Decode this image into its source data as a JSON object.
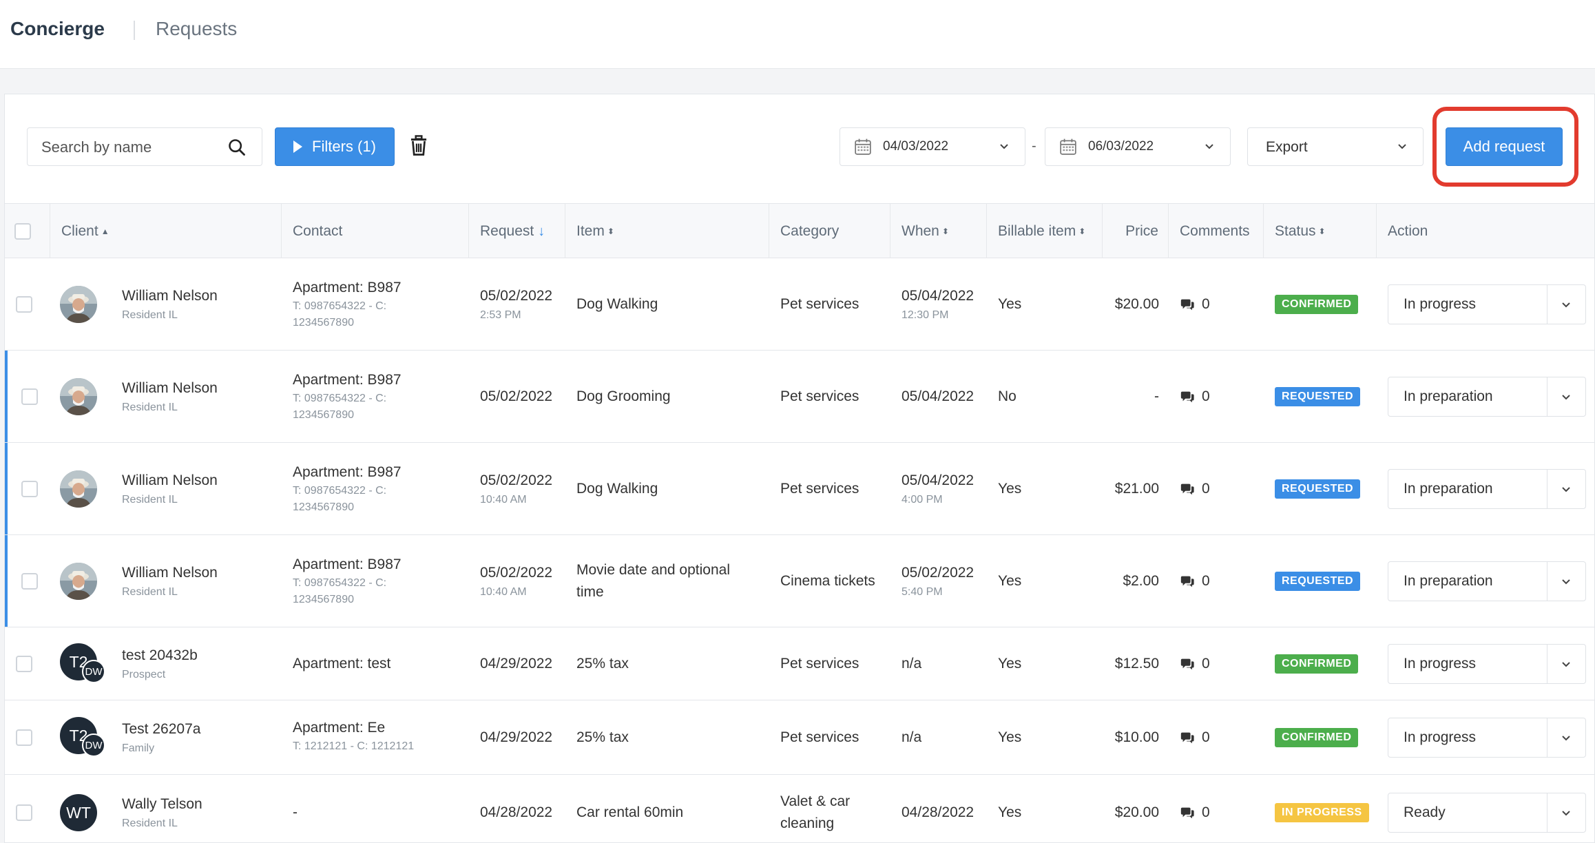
{
  "app": {
    "title": "Concierge",
    "breadcrumb": "Requests"
  },
  "toolbar": {
    "search_placeholder": "Search by name",
    "filters_label": "Filters (1)",
    "date_from": "04/03/2022",
    "date_dash": "-",
    "date_to": "06/03/2022",
    "export_label": "Export",
    "add_request_label": "Add request",
    "highlight_color": "#e23b2e",
    "accent_color": "#3b8ee6"
  },
  "table": {
    "headers": {
      "client": "Client",
      "contact": "Contact",
      "request": "Request",
      "item": "Item",
      "category": "Category",
      "when": "When",
      "billable": "Billable item",
      "price": "Price",
      "comments": "Comments",
      "status": "Status",
      "action": "Action"
    },
    "rows": [
      {
        "client_name": "William Nelson",
        "client_role": "Resident IL",
        "contact_main": "Apartment: B987",
        "contact_sub1": "T: 0987654322 - C:",
        "contact_sub2": "1234567890",
        "request_date": "05/02/2022",
        "request_time": "2:53 PM",
        "item": "Dog Walking",
        "category": "Pet services",
        "when_date": "05/04/2022",
        "when_time": "12:30 PM",
        "billable": "Yes",
        "price": "$20.00",
        "comments": "0",
        "status": "CONFIRMED",
        "action": "In progress"
      },
      {
        "client_name": "William Nelson",
        "client_role": "Resident IL",
        "contact_main": "Apartment: B987",
        "contact_sub1": "T: 0987654322 - C:",
        "contact_sub2": "1234567890",
        "request_date": "05/02/2022",
        "request_time": "",
        "item": "Dog Grooming",
        "category": "Pet services",
        "when_date": "05/04/2022",
        "when_time": "",
        "billable": "No",
        "price": "-",
        "comments": "0",
        "status": "REQUESTED",
        "action": "In preparation"
      },
      {
        "client_name": "William Nelson",
        "client_role": "Resident IL",
        "contact_main": "Apartment: B987",
        "contact_sub1": "T: 0987654322 - C:",
        "contact_sub2": "1234567890",
        "request_date": "05/02/2022",
        "request_time": "10:40 AM",
        "item": "Dog Walking",
        "category": "Pet services",
        "when_date": "05/04/2022",
        "when_time": "4:00 PM",
        "billable": "Yes",
        "price": "$21.00",
        "comments": "0",
        "status": "REQUESTED",
        "action": "In preparation"
      },
      {
        "client_name": "William Nelson",
        "client_role": "Resident IL",
        "contact_main": "Apartment: B987",
        "contact_sub1": "T: 0987654322 - C:",
        "contact_sub2": "1234567890",
        "request_date": "05/02/2022",
        "request_time": "10:40 AM",
        "item": "Movie date and optional time",
        "category": "Cinema tickets",
        "when_date": "05/02/2022",
        "when_time": "5:40 PM",
        "billable": "Yes",
        "price": "$2.00",
        "comments": "0",
        "status": "REQUESTED",
        "action": "In preparation"
      },
      {
        "client_name": "test 20432b",
        "client_role": "Prospect",
        "avatar_initials": "T2",
        "avatar_mini": "DW",
        "contact_main": "Apartment: test",
        "contact_sub1": "",
        "contact_sub2": "",
        "request_date": "04/29/2022",
        "request_time": "",
        "item": "25% tax",
        "category": "Pet services",
        "when_date": "n/a",
        "when_time": "",
        "billable": "Yes",
        "price": "$12.50",
        "comments": "0",
        "status": "CONFIRMED",
        "action": "In progress"
      },
      {
        "client_name": "Test 26207a",
        "client_role": "Family",
        "avatar_initials": "T2",
        "avatar_mini": "DW",
        "contact_main": "Apartment: Ee",
        "contact_sub1": "T: 1212121 - C: 1212121",
        "contact_sub2": "",
        "request_date": "04/29/2022",
        "request_time": "",
        "item": "25% tax",
        "category": "Pet services",
        "when_date": "n/a",
        "when_time": "",
        "billable": "Yes",
        "price": "$10.00",
        "comments": "0",
        "status": "CONFIRMED",
        "action": "In progress"
      },
      {
        "client_name": "Wally Telson",
        "client_role": "Resident IL",
        "avatar_initials": "WT",
        "contact_main": "-",
        "contact_sub1": "",
        "contact_sub2": "",
        "request_date": "04/28/2022",
        "request_time": "",
        "item": "Car rental 60min",
        "category": "Valet & car cleaning",
        "when_date": "04/28/2022",
        "when_time": "",
        "billable": "Yes",
        "price": "$20.00",
        "comments": "0",
        "status": "IN PROGRESS",
        "action": "Ready"
      }
    ]
  },
  "status_colors": {
    "CONFIRMED": "#4cae4c",
    "REQUESTED": "#3b8ee6",
    "IN PROGRESS": "#f5c542"
  }
}
